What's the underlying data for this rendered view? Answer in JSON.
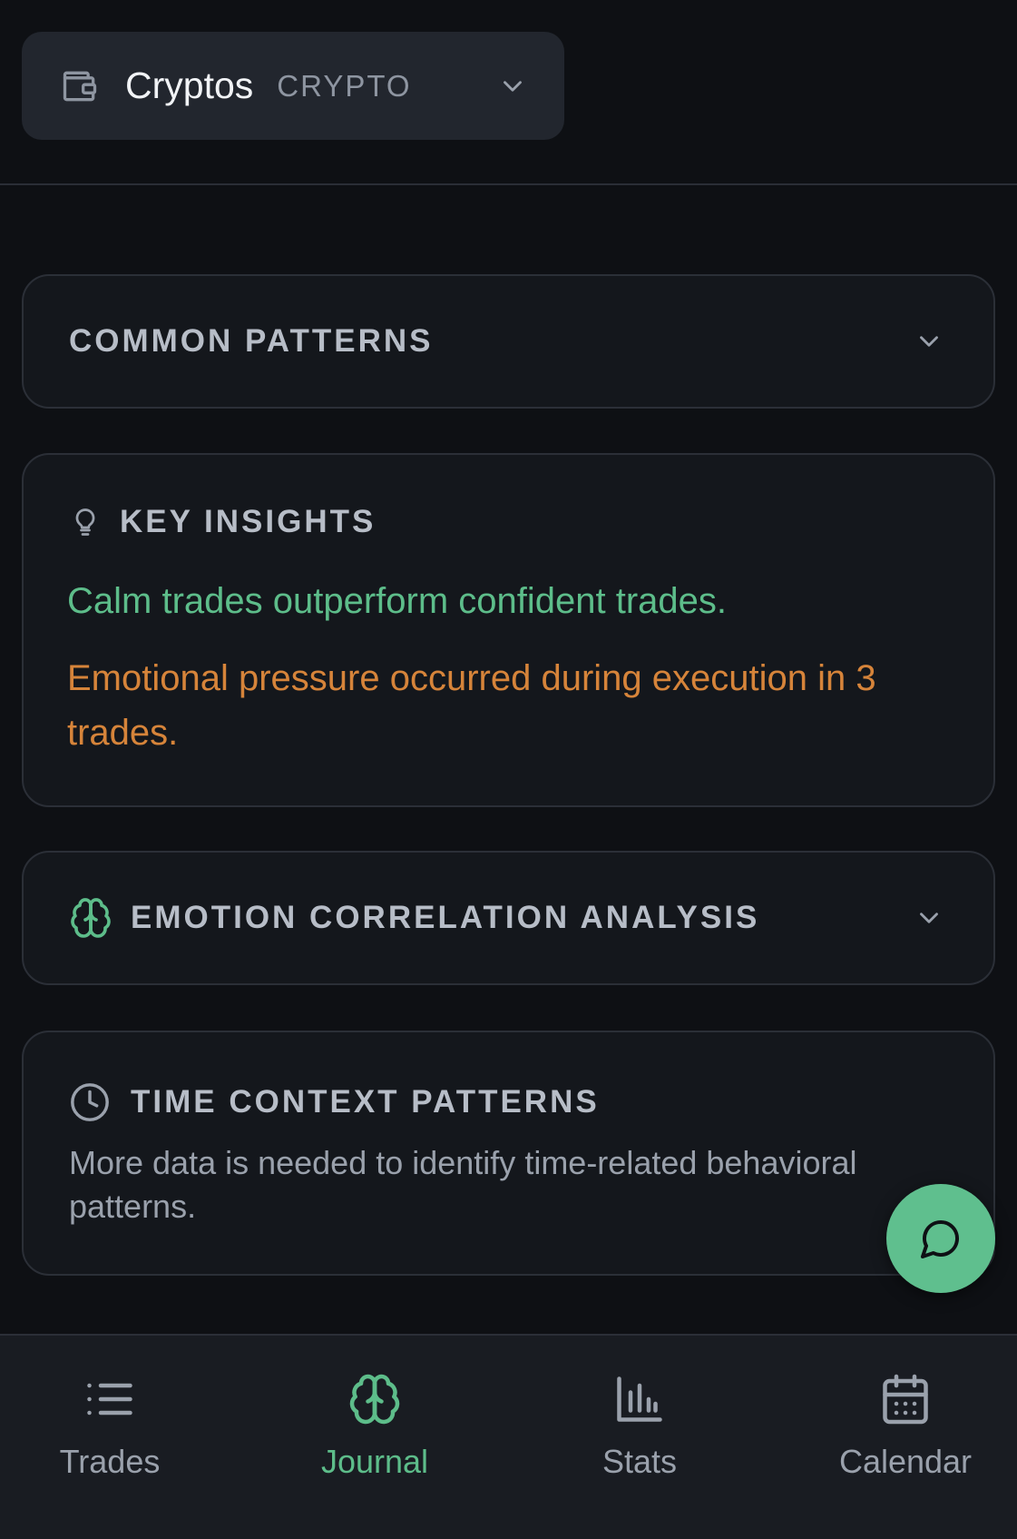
{
  "account": {
    "name": "Cryptos",
    "type": "CRYPTO"
  },
  "sections": {
    "common_patterns": {
      "title": "COMMON PATTERNS"
    },
    "key_insights": {
      "title": "KEY INSIGHTS",
      "positive": "Calm trades outperform confident trades.",
      "warning": "Emotional pressure occurred during execution in 3 trades."
    },
    "emotion_correlation": {
      "title": "EMOTION CORRELATION ANALYSIS"
    },
    "time_context": {
      "title": "TIME CONTEXT PATTERNS",
      "message": "More data is needed to identify time-related behavioral patterns."
    }
  },
  "nav": {
    "items": [
      {
        "label": "Trades",
        "icon": "list-icon",
        "active": false
      },
      {
        "label": "Journal",
        "icon": "brain-icon",
        "active": true
      },
      {
        "label": "Stats",
        "icon": "bar-chart-icon",
        "active": false
      },
      {
        "label": "Calendar",
        "icon": "calendar-icon",
        "active": false
      }
    ]
  },
  "colors": {
    "background": "#0e1014",
    "accent_green": "#5dbd8a",
    "warning_orange": "#d6843a",
    "muted_text": "#9aa1ac"
  }
}
